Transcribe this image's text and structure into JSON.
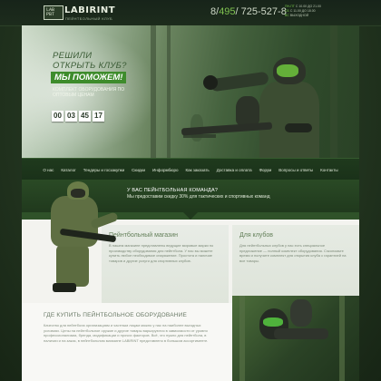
{
  "header": {
    "logo_mark": "LAB PBT",
    "logo_text": "LABIRINT",
    "logo_sub": "ПЕЙНТБОЛЬНЫЙ КЛУБ",
    "phone_prefix": "8/",
    "phone_mid": "495",
    "phone_rest": "/ 725-527-8",
    "contacts": {
      "line1_label": "ПН-ПТ",
      "line1_value": "С 10.00 ДО 21.00",
      "line2_label": "СБ",
      "line2_value": "С 11.00 ДО 18.00",
      "line3_label": "ВС",
      "line3_value": "ВЫХОДНОЙ"
    }
  },
  "hero": {
    "title_line1": "РЕШИЛИ",
    "title_line2": "ОТКРЫТЬ КЛУБ?",
    "answer": "МЫ ПОМОЖЕМ!",
    "desc": "КОМПЛЕКТ ОБОРУДОВАНИЯ ПО ОПТОВЫМ ЦЕНАМ",
    "timer": [
      "00",
      "03",
      "45",
      "17"
    ]
  },
  "nav": {
    "items": [
      "О нас",
      "Каталог",
      "Тендеры и госзакупки",
      "Скидки",
      "Информбюро",
      "Как заказать",
      "Доставка и оплата",
      "Форум",
      "Вопросы и ответы",
      "Контакты"
    ]
  },
  "team_banner": {
    "title": "У ВАС ПЕЙНТБОЛЬНАЯ КОМАНДА?",
    "text": "Мы предоставим скидку 30% для тактических и спортивных команд"
  },
  "cards": [
    {
      "title": "Пейнтбольный магазин",
      "text": "В нашем магазине представлены ведущие мировые марки по производству оборудования для пейнтбола. У нас вы можете купить любое необходимое снаряжение. Простота и наличие товаров и другие услуги для спортивных клубов."
    },
    {
      "title": "Для клубов",
      "text": "Для пейнтбольных клубов у нас есть специальное предложение — полный комплект оборудования. Сэкономьте время и получите комплект для открытия клуба с гарантией на все товары."
    }
  ],
  "lower": {
    "title": "ГДЕ КУПИТЬ ПЕЙНТБОЛЬНОЕ ОБОРУДОВАНИЕ",
    "text": "Качество для пейнтбола организациям и частным лицам можно у нас на наиболее выгодных условиях. Цены на пейнтбольное оружие и другие товары варьируются в зависимости от уровня профессионализма, бренда, модификации и прочих факторов. Всё, что нужно для пейнтбола, в наличии и на заказ, в пейнтбольном магазине LABIRINT представлено в большом ассортименте."
  }
}
